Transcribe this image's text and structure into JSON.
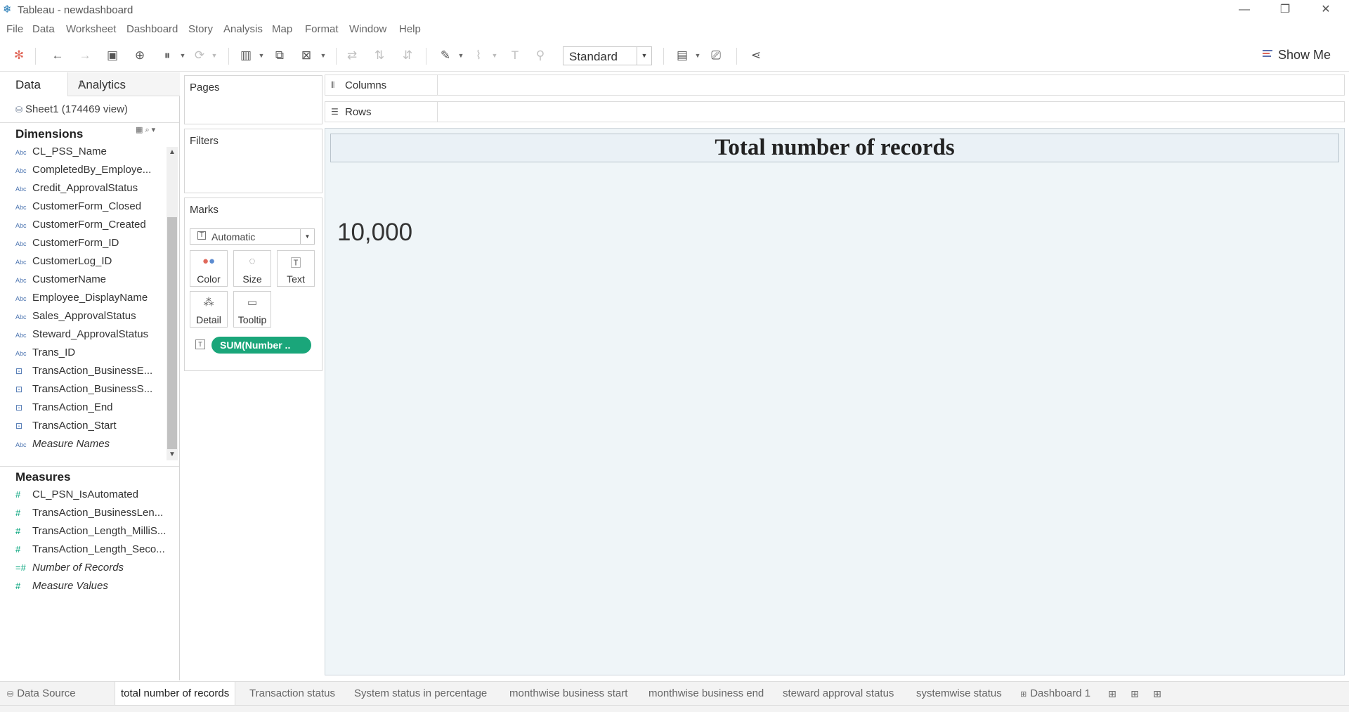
{
  "window": {
    "title": "Tableau - newdashboard",
    "controls": {
      "minimize": "—",
      "restore": "❐",
      "close": "✕"
    }
  },
  "menu": [
    "File",
    "Data",
    "Worksheet",
    "Dashboard",
    "Story",
    "Analysis",
    "Map",
    "Format",
    "Window",
    "Help"
  ],
  "toolbar": {
    "fit": "Standard",
    "show_me": "Show Me",
    "icons": [
      "tableau-logo-icon",
      "undo-icon",
      "redo-icon",
      "save-icon",
      "new-data-source-icon",
      "pause-updates-icon",
      "refresh-icon",
      "new-worksheet-icon",
      "duplicate-icon",
      "clear-sheet-icon",
      "swap-icon",
      "sort-ascending-icon",
      "sort-descending-icon",
      "highlight-icon",
      "group-icon",
      "show-labels-icon",
      "fix-axes-icon",
      "show-cards-icon",
      "presentation-icon",
      "share-icon"
    ]
  },
  "data_pane": {
    "tabs": {
      "data": "Data",
      "analytics": "Analytics"
    },
    "data_source": "Sheet1 (174469 view)",
    "dimensions_title": "Dimensions",
    "dimensions": [
      {
        "type": "Abc",
        "name": "CL_PSS_Name",
        "italic": false
      },
      {
        "type": "Abc",
        "name": "CompletedBy_Employe...",
        "italic": false
      },
      {
        "type": "Abc",
        "name": "Credit_ApprovalStatus",
        "italic": false
      },
      {
        "type": "Abc",
        "name": "CustomerForm_Closed",
        "italic": false
      },
      {
        "type": "Abc",
        "name": "CustomerForm_Created",
        "italic": false
      },
      {
        "type": "Abc",
        "name": "CustomerForm_ID",
        "italic": false
      },
      {
        "type": "Abc",
        "name": "CustomerLog_ID",
        "italic": false
      },
      {
        "type": "Abc",
        "name": "CustomerName",
        "italic": false
      },
      {
        "type": "Abc",
        "name": "Employee_DisplayName",
        "italic": false
      },
      {
        "type": "Abc",
        "name": "Sales_ApprovalStatus",
        "italic": false
      },
      {
        "type": "Abc",
        "name": "Steward_ApprovalStatus",
        "italic": false
      },
      {
        "type": "Abc",
        "name": "Trans_ID",
        "italic": false
      },
      {
        "type": "date",
        "name": "TransAction_BusinessE...",
        "italic": false
      },
      {
        "type": "date",
        "name": "TransAction_BusinessS...",
        "italic": false
      },
      {
        "type": "date",
        "name": "TransAction_End",
        "italic": false
      },
      {
        "type": "date",
        "name": "TransAction_Start",
        "italic": false
      },
      {
        "type": "Abc",
        "name": "Measure Names",
        "italic": true
      }
    ],
    "measures_title": "Measures",
    "measures": [
      {
        "type": "#",
        "name": "CL_PSN_IsAutomated",
        "italic": false
      },
      {
        "type": "#",
        "name": "TransAction_BusinessLen...",
        "italic": false
      },
      {
        "type": "#",
        "name": "TransAction_Length_MilliS...",
        "italic": false
      },
      {
        "type": "#",
        "name": "TransAction_Length_Seco...",
        "italic": false
      },
      {
        "type": "=#",
        "name": "Number of Records",
        "italic": true
      },
      {
        "type": "#",
        "name": "Measure Values",
        "italic": true
      }
    ]
  },
  "cards": {
    "pages": "Pages",
    "filters": "Filters",
    "marks": "Marks",
    "mark_type": "Automatic",
    "mark_buttons": [
      {
        "name": "color",
        "label": "Color"
      },
      {
        "name": "size",
        "label": "Size"
      },
      {
        "name": "text",
        "label": "Text"
      },
      {
        "name": "detail",
        "label": "Detail"
      },
      {
        "name": "tooltip",
        "label": "Tooltip"
      }
    ],
    "pill": "SUM(Number .."
  },
  "shelves": {
    "columns": "Columns",
    "rows": "Rows"
  },
  "view": {
    "title": "Total number of records",
    "value": "10,000"
  },
  "sheet_tabs": [
    {
      "label": "Data Source",
      "icon": "data-source-icon",
      "active": false
    },
    {
      "label": "total number of records",
      "active": true
    },
    {
      "label": "Transaction status",
      "active": false
    },
    {
      "label": "System status in percentage",
      "active": false
    },
    {
      "label": "monthwise business start",
      "active": false
    },
    {
      "label": "monthwise business end",
      "active": false
    },
    {
      "label": "steward approval status",
      "active": false
    },
    {
      "label": "systemwise status",
      "active": false
    },
    {
      "label": "Dashboard 1",
      "icon": "dashboard-icon",
      "active": false
    }
  ],
  "colors": {
    "pill": "#1aa67a",
    "view_bg": "#eff5f8",
    "dimension": "#4a73b0",
    "measure": "#00a37a"
  }
}
